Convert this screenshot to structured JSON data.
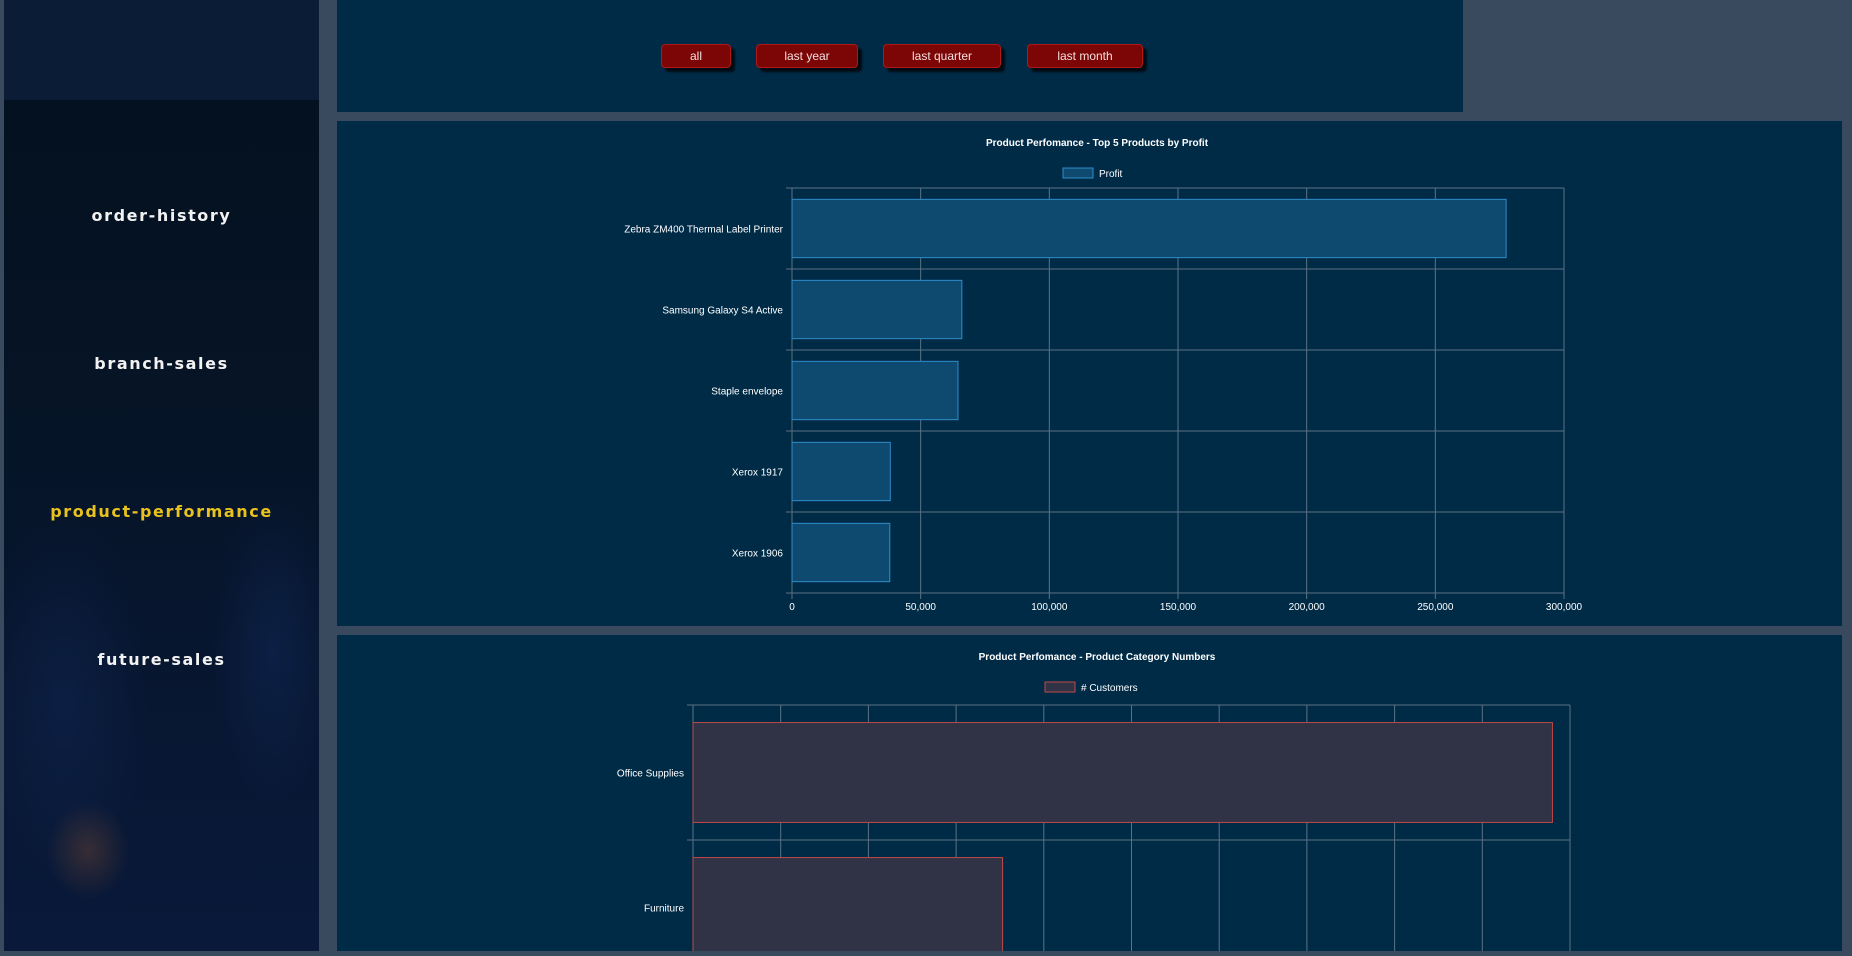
{
  "sidebar": {
    "items": [
      {
        "label": "order-history",
        "active": false
      },
      {
        "label": "branch-sales",
        "active": false
      },
      {
        "label": "product-performance",
        "active": true
      },
      {
        "label": "future-sales",
        "active": false
      }
    ]
  },
  "filters": [
    {
      "label": "all"
    },
    {
      "label": "last year"
    },
    {
      "label": "last quarter"
    },
    {
      "label": "last month"
    }
  ],
  "colors": {
    "profit_bar": "#0e4a6f",
    "profit_border": "#2e8cc8",
    "customers_bar": "#2f3345",
    "customers_border": "#c04848",
    "active_nav": "#e8c21e",
    "filter_button": "#7c0606"
  },
  "chart_data": [
    {
      "type": "bar",
      "orientation": "horizontal",
      "title": "Product Perfomance - Top 5 Products by Profit",
      "categories": [
        "Zebra ZM400 Thermal Label Printer",
        "Samsung Galaxy S4 Active",
        "Staple envelope",
        "Xerox 1917",
        "Xerox 1906"
      ],
      "series": [
        {
          "name": "Profit",
          "values": [
            277500,
            66000,
            64500,
            38200,
            38000
          ]
        }
      ],
      "xlim": [
        0,
        300000
      ],
      "xticks": [
        "0",
        "50,000",
        "100,000",
        "150,000",
        "200,000",
        "250,000",
        "300,000"
      ],
      "legend": "top",
      "grid": true
    },
    {
      "type": "bar",
      "orientation": "horizontal",
      "title": "Product Perfomance - Product Category Numbers",
      "categories": [
        "Office Supplies",
        "Furniture"
      ],
      "series": [
        {
          "name": "# Customers",
          "values": [
            98,
            35.3
          ]
        }
      ],
      "xlim": [
        0,
        100
      ],
      "legend": "top",
      "grid": true
    }
  ]
}
